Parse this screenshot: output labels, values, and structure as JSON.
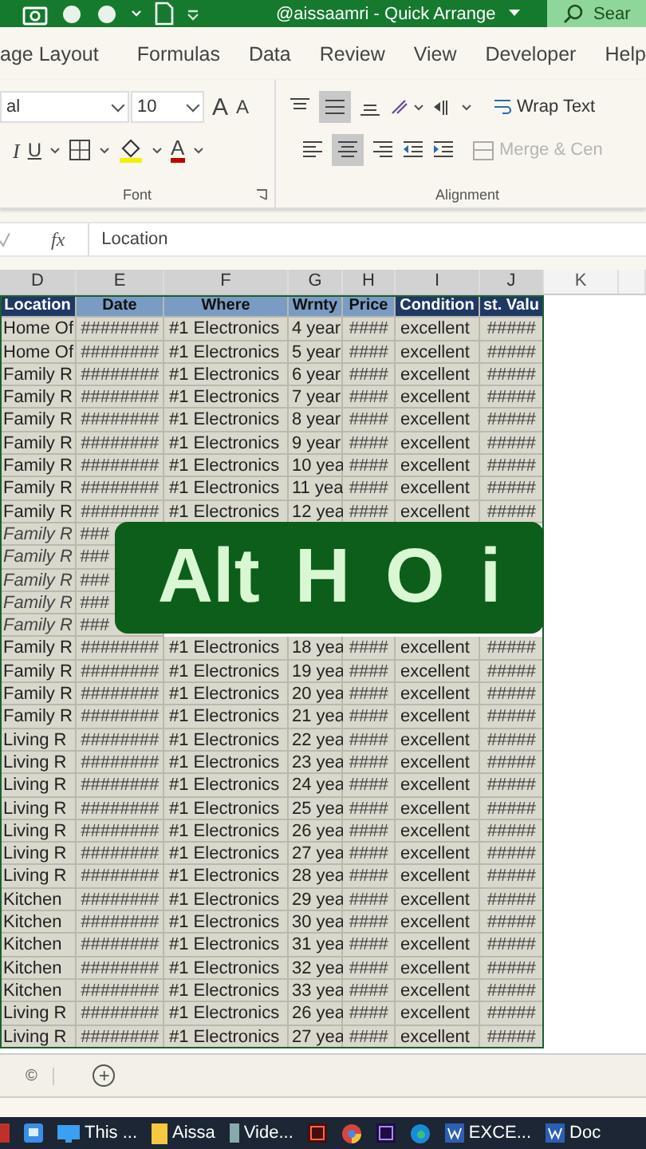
{
  "title_bar": {
    "title": "@aissaamri - Quick Arrange",
    "search": "Sear"
  },
  "ribbon_tabs": [
    {
      "label": "age Layout",
      "selected": false
    },
    {
      "label": "Formulas",
      "selected": false
    },
    {
      "label": "Data",
      "selected": false
    },
    {
      "label": "Review",
      "selected": false
    },
    {
      "label": "View",
      "selected": false
    },
    {
      "label": "Developer",
      "selected": false
    },
    {
      "label": "Help",
      "selected": false
    }
  ],
  "font_group": {
    "font_name": "al",
    "font_size": "10",
    "grow": "A",
    "shrink": "A",
    "italic": "I",
    "underline": "U",
    "font_color": "A",
    "label": "Font"
  },
  "alignment_group": {
    "wrap_text": "Wrap Text",
    "merge": {
      "label": "Merge & Cen",
      "disabled": true
    },
    "label": "Alignment"
  },
  "formula_bar": {
    "fx": "fx",
    "value": "Location"
  },
  "sheet": {
    "column_headers": [
      "D",
      "E",
      "F",
      "G",
      "H",
      "I",
      "J",
      "K"
    ],
    "header_row": [
      {
        "text": "Location",
        "kind": "dark"
      },
      {
        "text": "Date",
        "kind": "light"
      },
      {
        "text": "Where",
        "kind": "light"
      },
      {
        "text": "Wrnty",
        "kind": "light"
      },
      {
        "text": "Price",
        "kind": "light"
      },
      {
        "text": "Condition",
        "kind": "dark"
      },
      {
        "text": "st. Valu",
        "kind": "dark"
      }
    ],
    "rows": [
      [
        "Home Of",
        "########",
        "#1 Electronics",
        "4 year",
        "####",
        "excellent",
        "#####"
      ],
      [
        "Home Of",
        "########",
        "#1 Electronics",
        "5 year",
        "####",
        "excellent",
        "#####"
      ],
      [
        "Family R",
        "########",
        "#1 Electronics",
        "6 year",
        "####",
        "excellent",
        "#####"
      ],
      [
        "Family R",
        "########",
        "#1 Electronics",
        "7 year",
        "####",
        "excellent",
        "#####"
      ],
      [
        "Family R",
        "########",
        "#1 Electronics",
        "8 year",
        "####",
        "excellent",
        "#####"
      ],
      [
        "Family R",
        "########",
        "#1 Electronics",
        "9 year",
        "####",
        "excellent",
        "#####"
      ],
      [
        "Family R",
        "########",
        "#1 Electronics",
        "10 yea",
        "####",
        "excellent",
        "#####"
      ],
      [
        "Family R",
        "########",
        "#1 Electronics",
        "11 yea",
        "####",
        "excellent",
        "#####"
      ],
      [
        "Family R",
        "########",
        "#1 Electronics",
        "12 yea",
        "####",
        "excellent",
        "#####"
      ],
      [
        "Family R",
        "###"
      ],
      [
        "Family R",
        "###"
      ],
      [
        "Family R",
        "###"
      ],
      [
        "Family R",
        "###"
      ],
      [
        "Family R",
        "###"
      ],
      [
        "Family R",
        "########",
        "#1 Electronics",
        "18 yea",
        "####",
        "excellent",
        "#####"
      ],
      [
        "Family R",
        "########",
        "#1 Electronics",
        "19 yea",
        "####",
        "excellent",
        "#####"
      ],
      [
        "Family R",
        "########",
        "#1 Electronics",
        "20 yea",
        "####",
        "excellent",
        "#####"
      ],
      [
        "Family R",
        "########",
        "#1 Electronics",
        "21 yea",
        "####",
        "excellent",
        "#####"
      ],
      [
        "Living R",
        "########",
        "#1 Electronics",
        "22 yea",
        "####",
        "excellent",
        "#####"
      ],
      [
        "Living R",
        "########",
        "#1 Electronics",
        "23 yea",
        "####",
        "excellent",
        "#####"
      ],
      [
        "Living R",
        "########",
        "#1 Electronics",
        "24 yea",
        "####",
        "excellent",
        "#####"
      ],
      [
        "Living R",
        "########",
        "#1 Electronics",
        "25 yea",
        "####",
        "excellent",
        "#####"
      ],
      [
        "Living R",
        "########",
        "#1 Electronics",
        "26 yea",
        "####",
        "excellent",
        "#####"
      ],
      [
        "Living R",
        "########",
        "#1 Electronics",
        "27 yea",
        "####",
        "excellent",
        "#####"
      ],
      [
        "Living R",
        "########",
        "#1 Electronics",
        "28 yea",
        "####",
        "excellent",
        "#####"
      ],
      [
        "Kitchen",
        "########",
        "#1 Electronics",
        "29 yea",
        "####",
        "excellent",
        "#####"
      ],
      [
        "Kitchen",
        "########",
        "#1 Electronics",
        "30 yea",
        "####",
        "excellent",
        "#####"
      ],
      [
        "Kitchen",
        "########",
        "#1 Electronics",
        "31 yea",
        "####",
        "excellent",
        "#####"
      ],
      [
        "Kitchen",
        "########",
        "#1 Electronics",
        "32 yea",
        "####",
        "excellent",
        "#####"
      ],
      [
        "Kitchen",
        "########",
        "#1 Electronics",
        "33 yea",
        "####",
        "excellent",
        "#####"
      ],
      [
        "Living R",
        "########",
        "#1 Electronics",
        "26 yea",
        "####",
        "excellent",
        "#####"
      ],
      [
        "Living R",
        "########",
        "#1 Electronics",
        "27 yea",
        "####",
        "excellent",
        "#####"
      ]
    ]
  },
  "overlay": {
    "keys": [
      "Alt",
      "H",
      "O",
      "i"
    ]
  },
  "sheet_tabs": {
    "tab": "©",
    "add": "+"
  },
  "taskbar": {
    "items": [
      {
        "label": "This ..."
      },
      {
        "label": "Aissa"
      },
      {
        "label": "Vide..."
      },
      {
        "label": "EXCE..."
      },
      {
        "label": "Doc"
      }
    ]
  }
}
